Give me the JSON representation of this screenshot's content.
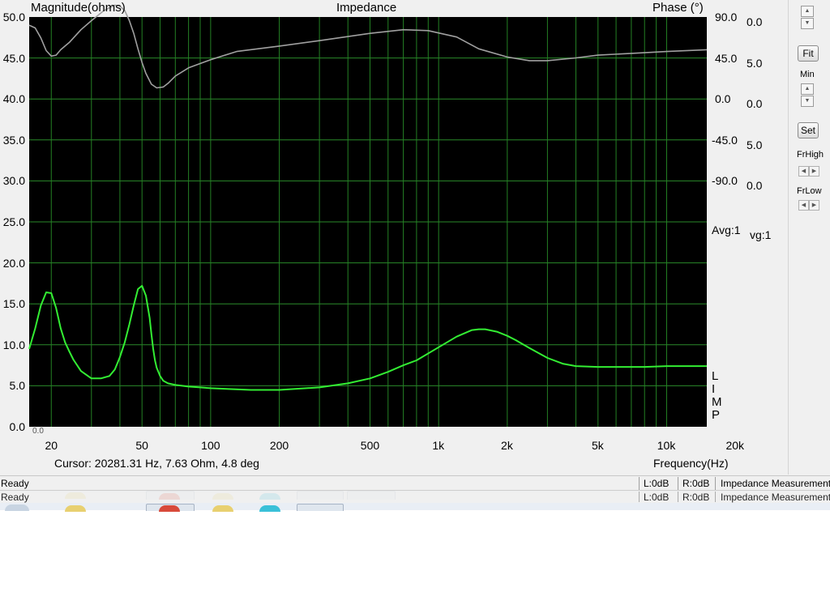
{
  "window": {
    "chart_title": "Impedance",
    "left_axis_title": "Magnitude(ohms)",
    "right_axis_title": "Phase (°)",
    "x_axis_title": "Frequency(Hz)",
    "cursor_readout": "Cursor: 20281.31 Hz, 7.63 Ohm, 4.8 deg",
    "avg_label": "Avg:1",
    "avg_label_clipped": "vg:1",
    "limp_letters": [
      "L",
      "I",
      "M",
      "P"
    ],
    "bottom_left_fragment": "0.0"
  },
  "chart_data": {
    "type": "line",
    "title": "Impedance",
    "xlabel": "Frequency(Hz)",
    "ylabel": "Magnitude(ohms)",
    "y2label": "Phase (°)",
    "xscale": "log",
    "xlim": [
      16,
      15000
    ],
    "ylim": [
      0,
      50
    ],
    "y2lim": [
      -90,
      90
    ],
    "grid": true,
    "x_ticks": [
      {
        "value": 20,
        "label": "20"
      },
      {
        "value": 50,
        "label": "50"
      },
      {
        "value": 100,
        "label": "100"
      },
      {
        "value": 200,
        "label": "200"
      },
      {
        "value": 500,
        "label": "500"
      },
      {
        "value": 1000,
        "label": "1k"
      },
      {
        "value": 2000,
        "label": "2k"
      },
      {
        "value": 5000,
        "label": "5k"
      },
      {
        "value": 10000,
        "label": "10k"
      },
      {
        "value": 20000,
        "label": "20k"
      }
    ],
    "y_ticks": [
      "0.0",
      "5.0",
      "10.0",
      "15.0",
      "20.0",
      "25.0",
      "30.0",
      "35.0",
      "40.0",
      "45.0",
      "50.0"
    ],
    "y2_ticks": [
      {
        "value": 90,
        "label": "90.0"
      },
      {
        "value": 45,
        "label": "45.0"
      },
      {
        "value": 0,
        "label": "0.0"
      },
      {
        "value": -45,
        "label": "-45.0"
      },
      {
        "value": -90,
        "label": "-90.0"
      }
    ],
    "ghost_ticks": [
      {
        "value": 90,
        "label": "0.0"
      },
      {
        "value": 45,
        "label": "5.0"
      },
      {
        "value": 0,
        "label": "0.0"
      },
      {
        "value": -45,
        "label": "5.0"
      },
      {
        "value": -90,
        "label": "0.0"
      }
    ],
    "series": [
      {
        "axis": "left",
        "color": "#33ee33",
        "x": [
          16,
          17,
          18,
          19,
          20,
          21,
          22,
          23,
          24,
          25,
          27,
          30,
          33,
          36,
          38,
          40,
          42,
          44,
          46,
          48,
          50,
          52,
          54,
          55,
          56,
          57,
          58,
          60,
          62,
          65,
          70,
          75,
          80,
          90,
          100,
          120,
          150,
          200,
          300,
          400,
          500,
          600,
          700,
          800,
          1000,
          1200,
          1400,
          1500,
          1600,
          1800,
          2000,
          2200,
          2500,
          3000,
          3500,
          4000,
          5000,
          6000,
          7000,
          8000,
          10000,
          12000,
          15000
        ],
        "y": [
          9.5,
          12,
          14.8,
          16.4,
          16.3,
          14.5,
          12,
          10.3,
          9.2,
          8.2,
          6.8,
          5.9,
          5.9,
          6.2,
          7,
          8.5,
          10.3,
          12.5,
          14.8,
          16.8,
          17.2,
          16,
          13.3,
          11.3,
          9.5,
          8.1,
          7.2,
          6.2,
          5.6,
          5.3,
          5.1,
          5,
          4.9,
          4.8,
          4.7,
          4.6,
          4.5,
          4.5,
          4.8,
          5.3,
          5.9,
          6.7,
          7.5,
          8.1,
          9.7,
          11.0,
          11.8,
          11.9,
          11.9,
          11.6,
          11.1,
          10.5,
          9.6,
          8.4,
          7.7,
          7.4,
          7.3,
          7.3,
          7.3,
          7.3,
          7.4,
          7.4,
          7.4
        ]
      },
      {
        "axis": "right",
        "color": "#a0a0a0",
        "x": [
          16,
          17,
          18,
          19,
          20,
          21,
          22,
          24,
          27,
          30,
          34,
          38,
          40,
          42,
          44,
          46,
          48,
          50,
          52,
          55,
          58,
          62,
          65,
          70,
          80,
          100,
          130,
          200,
          300,
          500,
          700,
          900,
          1200,
          1500,
          2000,
          2500,
          3000,
          4000,
          5000,
          7000,
          10000,
          15000
        ],
        "y": [
          81,
          78,
          67,
          53,
          47,
          48,
          54,
          62,
          76,
          86,
          97,
          103,
          102,
          97,
          86,
          72,
          55,
          40,
          28,
          16,
          12,
          13,
          17,
          25,
          34,
          43,
          52,
          58,
          64,
          72,
          76,
          75,
          68,
          55,
          46,
          42,
          42,
          45,
          48,
          50,
          52,
          54
        ]
      }
    ]
  },
  "side_panel": {
    "fit_label": "Fit",
    "min_label": "Min",
    "set_label": "Set",
    "frhigh_label": "FrHigh",
    "frlow_label": "FrLow"
  },
  "status": {
    "ready": "Ready",
    "l_level": "L:0dB",
    "r_level": "R:0dB",
    "mode": "Impedance Measurement"
  },
  "colors": {
    "plot_bg": "#000000",
    "grid_h": "#2a8a2a",
    "grid_v": "#248024",
    "magnitude": "#33ee33",
    "phase": "#a0a0a0"
  }
}
